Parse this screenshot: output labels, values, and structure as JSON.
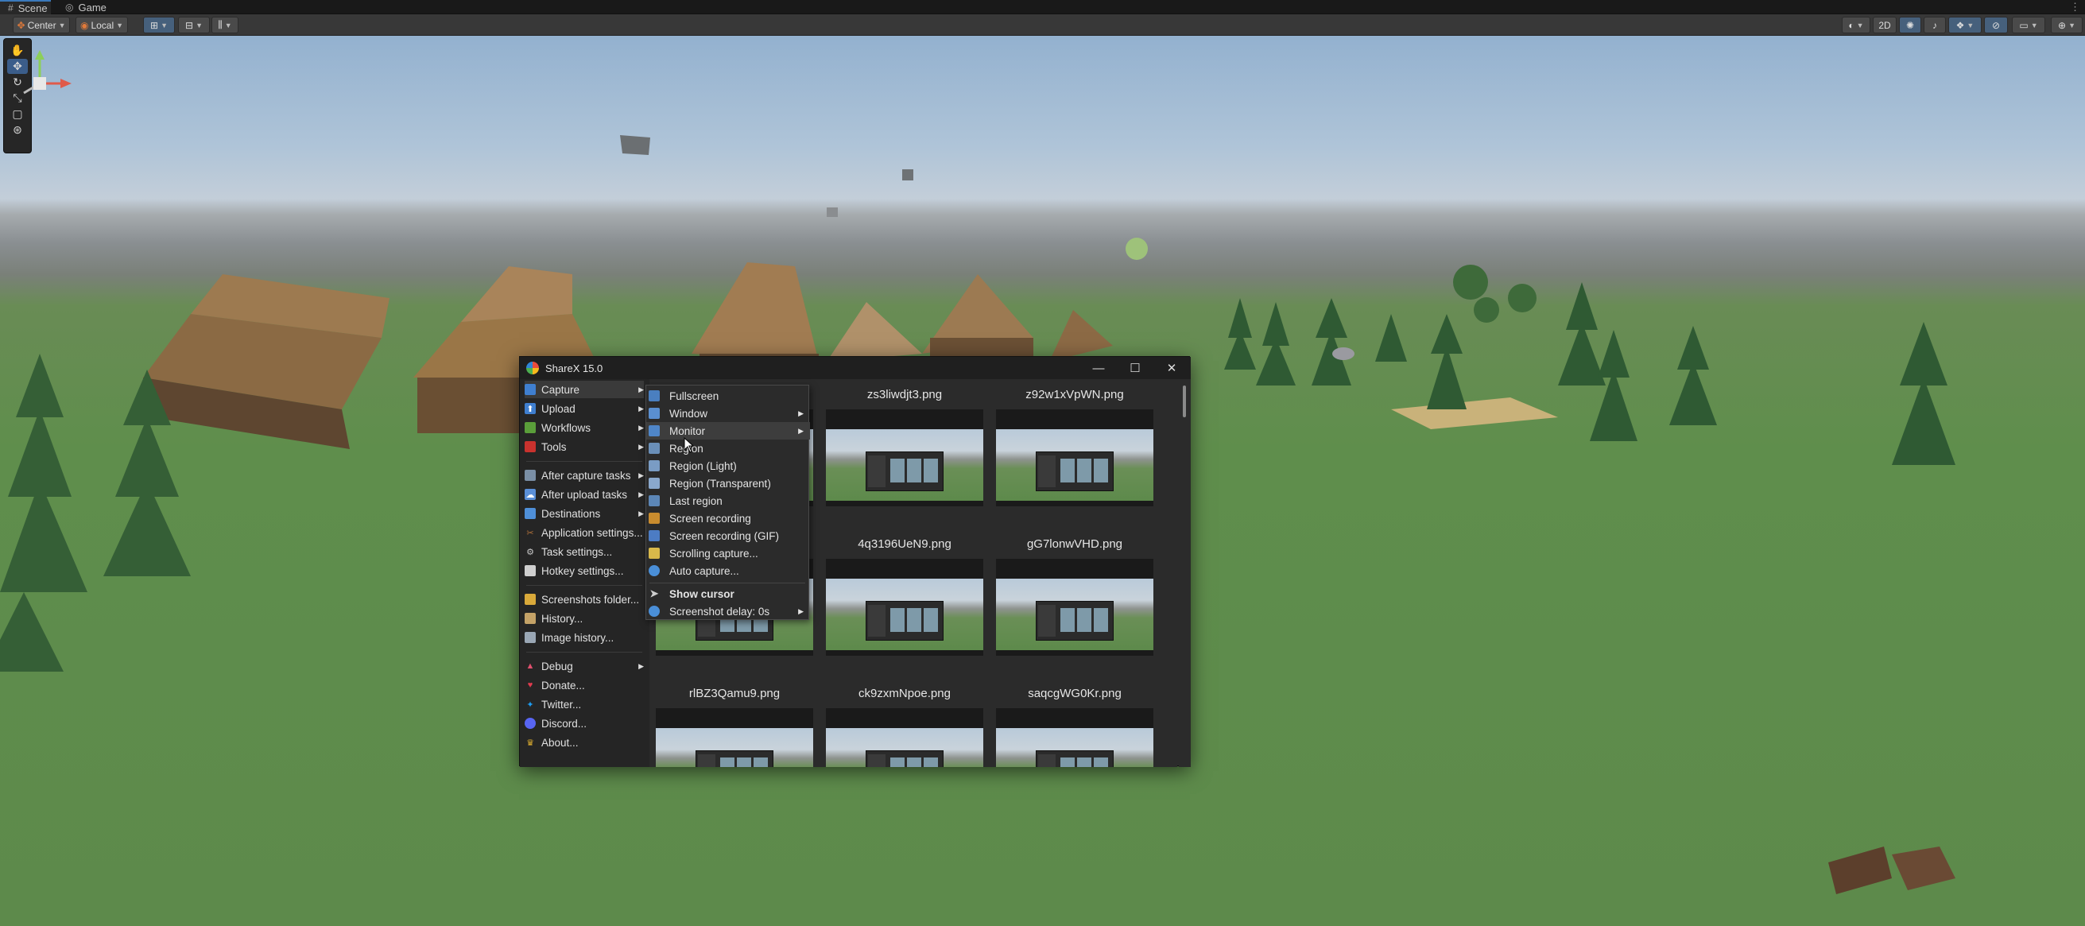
{
  "unity": {
    "tabs": [
      {
        "label": "Scene",
        "icon": "hash-icon"
      },
      {
        "label": "Game",
        "icon": "gamepad-icon"
      }
    ],
    "toolbar": {
      "pivot_mode": "Center",
      "pivot_rotation": "Local",
      "view_2d": "2D"
    }
  },
  "sharex": {
    "title": "ShareX 15.0",
    "menu": [
      {
        "label": "Capture",
        "icon": "capture-icon",
        "color": "#3f7fd0",
        "submenu": true
      },
      {
        "label": "Upload",
        "icon": "upload-icon",
        "color": "#3f7fd0",
        "submenu": true
      },
      {
        "label": "Workflows",
        "icon": "workflows-icon",
        "color": "#5a9e3a",
        "submenu": true
      },
      {
        "label": "Tools",
        "icon": "tools-icon",
        "color": "#c9322e",
        "submenu": true
      },
      {
        "label": "After capture tasks",
        "icon": "after-capture-icon",
        "color": "#7a8fa6",
        "submenu": true
      },
      {
        "label": "After upload tasks",
        "icon": "after-upload-icon",
        "color": "#5a8fd8",
        "submenu": true
      },
      {
        "label": "Destinations",
        "icon": "destinations-icon",
        "color": "#4f8fd8",
        "submenu": true
      },
      {
        "label": "Application settings...",
        "icon": "app-settings-icon",
        "color": "#b0703a",
        "submenu": false
      },
      {
        "label": "Task settings...",
        "icon": "task-settings-icon",
        "color": "#9aa0a6",
        "submenu": false
      },
      {
        "label": "Hotkey settings...",
        "icon": "hotkey-settings-icon",
        "color": "#cfcfcf",
        "submenu": false
      },
      {
        "label": "Screenshots folder...",
        "icon": "screenshots-folder-icon",
        "color": "#d9a93a",
        "submenu": false
      },
      {
        "label": "History...",
        "icon": "history-icon",
        "color": "#c4a267",
        "submenu": false
      },
      {
        "label": "Image history...",
        "icon": "image-history-icon",
        "color": "#9aa7b5",
        "submenu": false
      },
      {
        "label": "Debug",
        "icon": "debug-icon",
        "color": "#e0506e",
        "submenu": true
      },
      {
        "label": "Donate...",
        "icon": "heart-icon",
        "color": "#e03b4e",
        "submenu": false
      },
      {
        "label": "Twitter...",
        "icon": "twitter-icon",
        "color": "#1d9bf0",
        "submenu": false
      },
      {
        "label": "Discord...",
        "icon": "discord-icon",
        "color": "#5865f2",
        "submenu": false
      },
      {
        "label": "About...",
        "icon": "crown-icon",
        "color": "#e0b030",
        "submenu": false
      }
    ],
    "thumbnails": [
      {
        "name": ""
      },
      {
        "name": "zs3liwdjt3.png"
      },
      {
        "name": "z92w1xVpWN.png"
      },
      {
        "name": ""
      },
      {
        "name": "4q3196UeN9.png"
      },
      {
        "name": "gG7lonwVHD.png"
      },
      {
        "name": "rlBZ3Qamu9.png"
      },
      {
        "name": "ck9zxmNpoe.png"
      },
      {
        "name": "saqcgWG0Kr.png"
      }
    ],
    "capture_submenu": [
      {
        "label": "Fullscreen",
        "icon": "fullscreen-icon",
        "color": "#4a7fc0",
        "submenu": false
      },
      {
        "label": "Window",
        "icon": "window-icon",
        "color": "#5a8fd0",
        "submenu": true
      },
      {
        "label": "Monitor",
        "icon": "monitor-icon",
        "color": "#4f86c8",
        "submenu": true
      },
      {
        "label": "Region",
        "icon": "region-icon",
        "color": "#6a8fb8",
        "submenu": false
      },
      {
        "label": "Region (Light)",
        "icon": "region-light-icon",
        "color": "#7a9cc4",
        "submenu": false
      },
      {
        "label": "Region (Transparent)",
        "icon": "region-transparent-icon",
        "color": "#8aa8cc",
        "submenu": false
      },
      {
        "label": "Last region",
        "icon": "last-region-icon",
        "color": "#5c86b6",
        "submenu": false
      },
      {
        "label": "Screen recording",
        "icon": "screen-recording-icon",
        "color": "#c98c2e",
        "submenu": false
      },
      {
        "label": "Screen recording (GIF)",
        "icon": "screen-recording-gif-icon",
        "color": "#4c7cc4",
        "submenu": false
      },
      {
        "label": "Scrolling capture...",
        "icon": "scrolling-capture-icon",
        "color": "#d8b84a",
        "submenu": false
      },
      {
        "label": "Auto capture...",
        "icon": "auto-capture-icon",
        "color": "#4a8fd8",
        "submenu": false
      },
      {
        "label": "Show cursor",
        "icon": "cursor-icon",
        "color": "#cfcfcf",
        "submenu": false
      },
      {
        "label": "Screenshot delay: 0s",
        "icon": "clock-icon",
        "color": "#4a8fd8",
        "submenu": true
      }
    ]
  }
}
